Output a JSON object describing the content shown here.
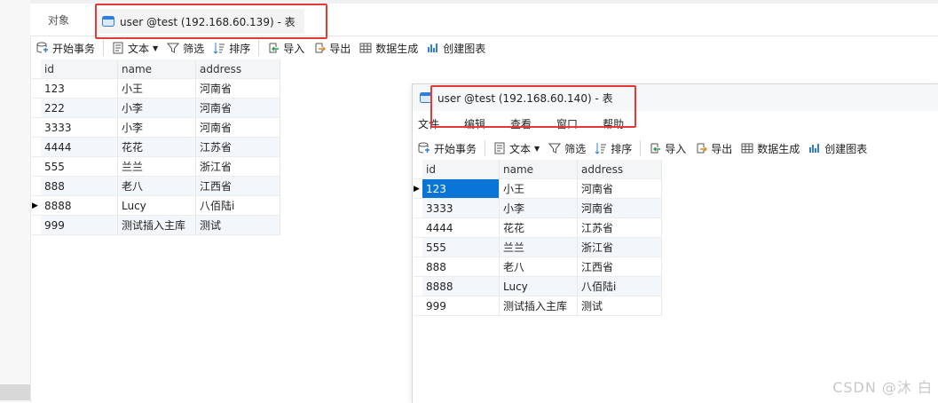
{
  "main_tabs": {
    "objects_label": "对象",
    "active_tab_label": "user @test (192.168.60.139) - 表"
  },
  "toolbar": {
    "begin_transaction": "开始事务",
    "text": "文本",
    "filter": "筛选",
    "sort": "排序",
    "import": "导入",
    "export": "导出",
    "data_generation": "数据生成",
    "create_chart": "创建图表"
  },
  "grid_main": {
    "columns": [
      "id",
      "name",
      "address"
    ],
    "rows": [
      [
        "123",
        "小王",
        "河南省"
      ],
      [
        "222",
        "小李",
        "河南省"
      ],
      [
        "3333",
        "小李",
        "河南省"
      ],
      [
        "4444",
        "花花",
        "江苏省"
      ],
      [
        "555",
        "兰兰",
        "浙江省"
      ],
      [
        "888",
        "老八",
        "江西省"
      ],
      [
        "8888",
        "Lucy",
        "八佰陆i"
      ],
      [
        "999",
        "测试插入主库",
        "测试"
      ]
    ]
  },
  "second_window": {
    "title": "user @test (192.168.60.140) - 表",
    "menu": [
      "文件",
      "编辑",
      "查看",
      "窗口",
      "帮助"
    ],
    "columns": [
      "id",
      "name",
      "address"
    ],
    "rows": [
      [
        "123",
        "小王",
        "河南省"
      ],
      [
        "3333",
        "小李",
        "河南省"
      ],
      [
        "4444",
        "花花",
        "江苏省"
      ],
      [
        "555",
        "兰兰",
        "浙江省"
      ],
      [
        "888",
        "老八",
        "江西省"
      ],
      [
        "8888",
        "Lucy",
        "八佰陆i"
      ],
      [
        "999",
        "测试插入主库",
        "测试"
      ]
    ]
  },
  "watermark": "CSDN @沐  白",
  "colors": {
    "selection": "#0a74d6",
    "annotation_box": "#e53935",
    "table_icon": "#2f7fd8"
  }
}
